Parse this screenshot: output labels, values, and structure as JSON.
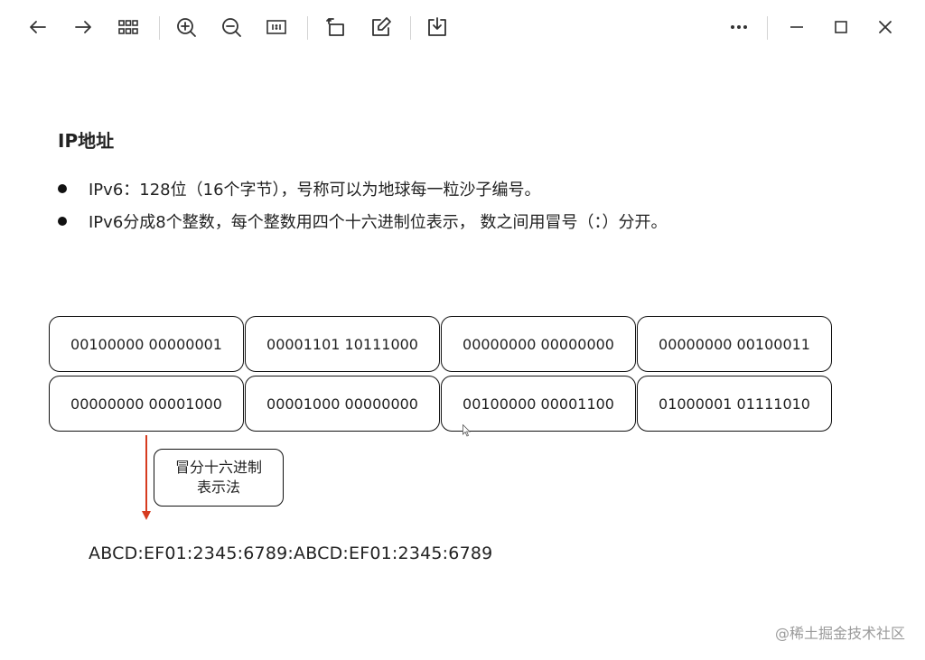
{
  "toolbar": {
    "buttons": [
      "back",
      "forward",
      "grid-view",
      "zoom-in",
      "zoom-out",
      "actual-size",
      "rotate",
      "edit",
      "download",
      "more",
      "minimize",
      "maximize",
      "close"
    ]
  },
  "slide": {
    "heading": "IP地址",
    "bullets": [
      "IPv6：128位（16个字节），号称可以为地球每一粒沙子编号。",
      "IPv6分成8个整数，每个整数用四个十六进制位表示， 数之间用冒号（：）分开。"
    ],
    "cells": [
      [
        "00100000 00000001",
        "00001101 10111000",
        "00000000 00000000",
        "00000000 00100011"
      ],
      [
        "00000000 00001000",
        "00001000 00000000",
        "00100000 00001100",
        "01000001 01111010"
      ]
    ],
    "callout_line1": "冒分十六进制",
    "callout_line2": "表示法",
    "result": "ABCD:EF01:2345:6789:ABCD:EF01:2345:6789"
  },
  "watermark": "@稀土掘金技术社区",
  "colors": {
    "arrow": "#d63b1f",
    "text": "#222222",
    "watermark": "#9a9a9a"
  }
}
